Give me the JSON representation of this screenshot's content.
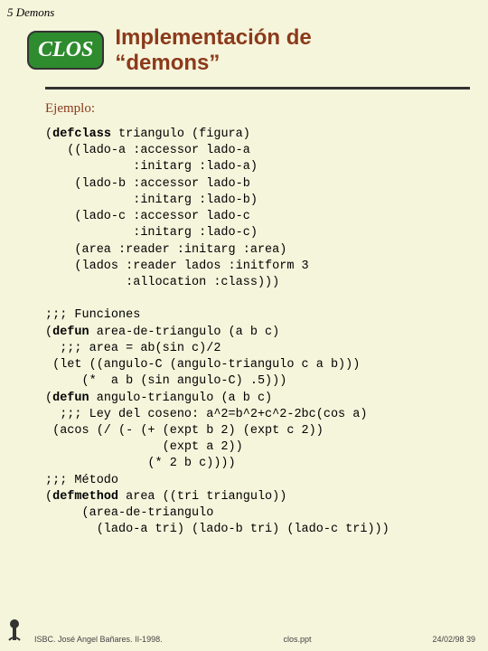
{
  "chapter": "5  Demons",
  "badge": "CLOS",
  "title_line1": "Implementación de",
  "title_line2": "“demons”",
  "ejemplo": "Ejemplo:",
  "code": {
    "l01a": "(",
    "l01k": "defclass",
    "l01b": " triangulo (figura)",
    "l02": "   ((lado-a :accessor lado-a",
    "l03": "            :initarg :lado-a)",
    "l04": "    (lado-b :accessor lado-b",
    "l05": "            :initarg :lado-b)",
    "l06": "    (lado-c :accessor lado-c",
    "l07": "            :initarg :lado-c)",
    "l08": "    (area :reader :initarg :area)",
    "l09": "    (lados :reader lados :initform 3",
    "l10": "           :allocation :class)))",
    "l11": "",
    "l12": ";;; Funciones",
    "l13a": "(",
    "l13k": "defun",
    "l13b": " area-de-triangulo (a b c)",
    "l14": "  ;;; area = ab(sin c)/2",
    "l15": " (let ((angulo-C (angulo-triangulo c a b)))",
    "l16": "     (*  a b (sin angulo-C) .5)))",
    "l17a": "(",
    "l17k": "defun",
    "l17b": " angulo-triangulo (a b c)",
    "l18": "  ;;; Ley del coseno: a^2=b^2+c^2-2bc(cos a)",
    "l19": " (acos (/ (- (+ (expt b 2) (expt c 2))",
    "l20": "                (expt a 2))",
    "l21": "              (* 2 b c))))",
    "l22": ";;; Método",
    "l23a": "(",
    "l23k": "defmethod",
    "l23b": " area ((tri triangulo))",
    "l24": "     (area-de-triangulo",
    "l25": "       (lado-a tri) (lado-b tri) (lado-c tri)))"
  },
  "footer": {
    "left": "ISBC. José Angel Bañares. II-1998.",
    "mid": "clos.ppt",
    "right": "24/02/98  39"
  }
}
